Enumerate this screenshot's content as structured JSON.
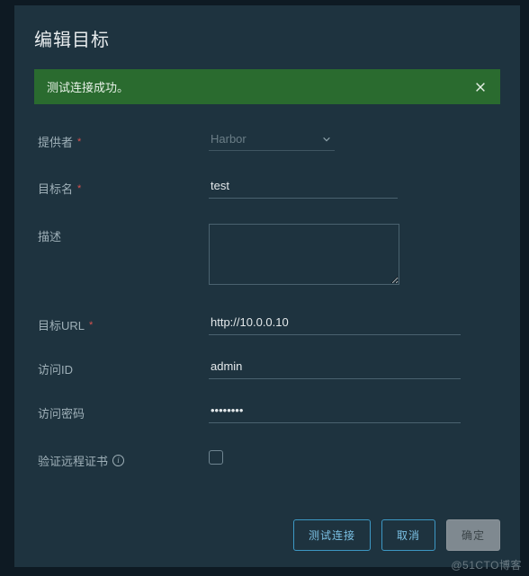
{
  "dialog": {
    "title": "编辑目标"
  },
  "alert": {
    "message": "测试连接成功。"
  },
  "form": {
    "provider": {
      "label": "提供者",
      "value": "Harbor"
    },
    "name": {
      "label": "目标名",
      "value": "test"
    },
    "description": {
      "label": "描述",
      "value": ""
    },
    "url": {
      "label": "目标URL",
      "value": "http://10.0.0.10"
    },
    "access_id": {
      "label": "访问ID",
      "value": "admin"
    },
    "access_secret": {
      "label": "访问密码",
      "value": "••••••••"
    },
    "verify_cert": {
      "label": "验证远程证书",
      "checked": false
    }
  },
  "footer": {
    "test": "测试连接",
    "cancel": "取消",
    "ok": "确定"
  },
  "watermark": "@51CTO博客"
}
